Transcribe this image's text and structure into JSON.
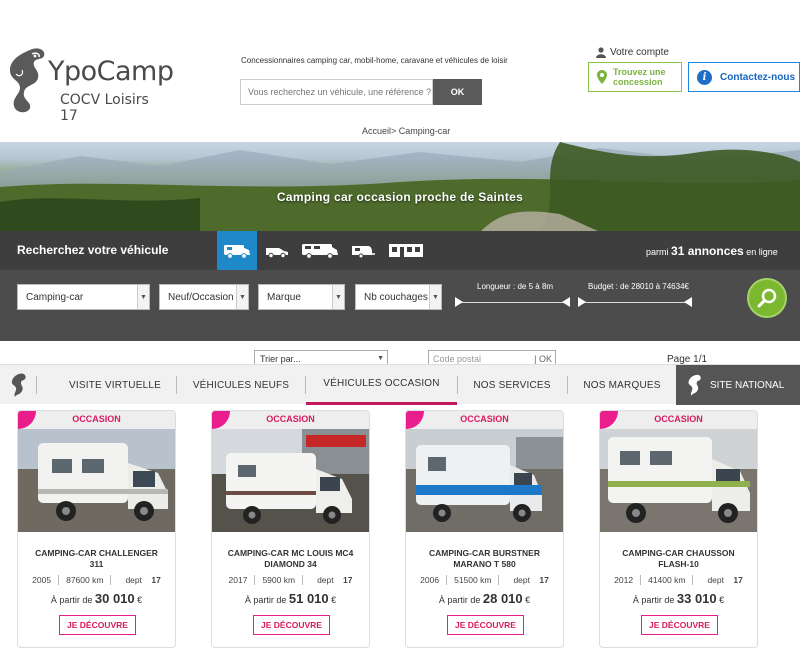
{
  "header": {
    "logo_name": "YpoCamp",
    "logo_sub": "COCV Loisirs 17",
    "tagline": "Concessionnaires camping car, mobil-home, caravane et véhicules de loisir",
    "search_placeholder": "Vous recherchez un véhicule, une référence ?",
    "search_button": "OK",
    "account_label": "Votre compte",
    "dealer_button_line1": "Trouvez une",
    "dealer_button_line2": "concession",
    "contact_button": "Contactez-nous",
    "breadcrumb": "Accueil> Camping-car"
  },
  "hero": {
    "title": "Camping car occasion proche de Saintes"
  },
  "search_panel": {
    "title": "Recherchez votre véhicule",
    "count_prefix": "parmi",
    "count_value": "31 annonces",
    "count_suffix": "en ligne",
    "filters": [
      "Camping-car",
      "Neuf/Occasion",
      "Marque",
      "Nb couchages"
    ],
    "length_label": "Longueur : de 5 à 8m",
    "budget_label": "Budget : de 28010 à 74634€"
  },
  "sort_bar": {
    "sort_placeholder": "Trier par...",
    "postal_placeholder": "Code postal",
    "postal_ok": "OK",
    "page_info": "Page 1/1"
  },
  "nav": {
    "items": [
      "VISITE VIRTUELLE",
      "VÉHICULES NEUFS",
      "VÉHICULES OCCASION",
      "NOS SERVICES",
      "NOS MARQUES"
    ],
    "national": "SITE NATIONAL"
  },
  "cards": [
    {
      "flag": "OCCASION",
      "title_line1": "CAMPING-CAR CHALLENGER",
      "title_line2": "311",
      "year": "2005",
      "km": "87600 km",
      "dept_label": "dept",
      "dept": "17",
      "price_prefix": "À partir de",
      "price": "30 010",
      "currency": "€",
      "button": "JE DÉCOUVRE"
    },
    {
      "flag": "OCCASION",
      "title_line1": "CAMPING-CAR MC LOUIS MC4",
      "title_line2": "DIAMOND 34",
      "year": "2017",
      "km": "5900 km",
      "dept_label": "dept",
      "dept": "17",
      "price_prefix": "À partir de",
      "price": "51 010",
      "currency": "€",
      "button": "JE DÉCOUVRE"
    },
    {
      "flag": "OCCASION",
      "title_line1": "CAMPING-CAR BURSTNER",
      "title_line2": "MARANO T 580",
      "year": "2006",
      "km": "51500 km",
      "dept_label": "dept",
      "dept": "17",
      "price_prefix": "À partir de",
      "price": "28 010",
      "currency": "€",
      "button": "JE DÉCOUVRE"
    },
    {
      "flag": "OCCASION",
      "title_line1": "CAMPING-CAR CHAUSSON",
      "title_line2": "FLASH-10",
      "year": "2012",
      "km": "41400 km",
      "dept_label": "dept",
      "dept": "17",
      "price_prefix": "À partir de",
      "price": "33 010",
      "currency": "€",
      "button": "JE DÉCOUVRE"
    }
  ],
  "colors": {
    "accent_pink": "#d81b60",
    "accent_green": "#7cb82f",
    "accent_blue": "#1e88c8",
    "panel_gray": "#4c4c4c"
  }
}
